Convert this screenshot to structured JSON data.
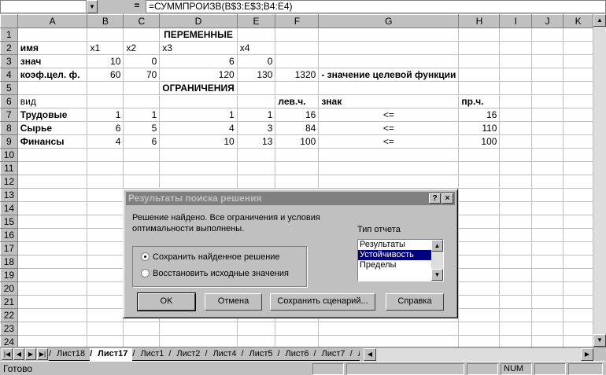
{
  "formula_bar": {
    "name_box": "",
    "equals": "=",
    "formula": "=СУММПРОИЗВ(B$3:E$3;B4:E4)"
  },
  "columns": [
    "A",
    "B",
    "C",
    "D",
    "E",
    "F",
    "G",
    "H",
    "I",
    "J",
    "K"
  ],
  "rows": [
    [
      "",
      "",
      "",
      "ПЕРЕМЕННЫЕ",
      "",
      "",
      "",
      "",
      "",
      "",
      ""
    ],
    [
      "имя",
      "x1",
      "x2",
      "x3",
      "x4",
      "",
      "",
      "",
      "",
      "",
      ""
    ],
    [
      "знач",
      "10",
      "0",
      "6",
      "0",
      "",
      "",
      "",
      "",
      "",
      ""
    ],
    [
      "коэф.цел. ф.",
      "60",
      "70",
      "120",
      "130",
      "1320",
      "- значение целевой функции",
      "",
      "",
      "",
      ""
    ],
    [
      "",
      "",
      "",
      "ОГРАНИЧЕНИЯ",
      "",
      "",
      "",
      "",
      "",
      "",
      ""
    ],
    [
      "вид",
      "",
      "",
      "",
      "",
      "лев.ч.",
      "знак",
      "пр.ч.",
      "",
      "",
      ""
    ],
    [
      "Трудовые",
      "1",
      "1",
      "1",
      "1",
      "16",
      "<=",
      "16",
      "",
      "",
      ""
    ],
    [
      "Сырье",
      "6",
      "5",
      "4",
      "3",
      "84",
      "<=",
      "110",
      "",
      "",
      ""
    ],
    [
      "Финансы",
      "4",
      "6",
      "10",
      "13",
      "100",
      "<=",
      "100",
      "",
      "",
      ""
    ],
    [
      "",
      "",
      "",
      "",
      "",
      "",
      "",
      "",
      "",
      "",
      ""
    ],
    [
      "",
      "",
      "",
      "",
      "",
      "",
      "",
      "",
      "",
      "",
      ""
    ],
    [
      "",
      "",
      "",
      "",
      "",
      "",
      "",
      "",
      "",
      "",
      ""
    ],
    [
      "",
      "",
      "",
      "",
      "",
      "",
      "",
      "",
      "",
      "",
      ""
    ],
    [
      "",
      "",
      "",
      "",
      "",
      "",
      "",
      "",
      "",
      "",
      ""
    ],
    [
      "",
      "",
      "",
      "",
      "",
      "",
      "",
      "",
      "",
      "",
      ""
    ],
    [
      "",
      "",
      "",
      "",
      "",
      "",
      "",
      "",
      "",
      "",
      ""
    ],
    [
      "",
      "",
      "",
      "",
      "",
      "",
      "",
      "",
      "",
      "",
      ""
    ],
    [
      "",
      "",
      "",
      "",
      "",
      "",
      "",
      "",
      "",
      "",
      ""
    ],
    [
      "",
      "",
      "",
      "",
      "",
      "",
      "",
      "",
      "",
      "",
      ""
    ],
    [
      "",
      "",
      "",
      "",
      "",
      "",
      "",
      "",
      "",
      "",
      ""
    ],
    [
      "",
      "",
      "",
      "",
      "",
      "",
      "",
      "",
      "",
      "",
      ""
    ],
    [
      "",
      "",
      "",
      "",
      "",
      "",
      "",
      "",
      "",
      "",
      ""
    ],
    [
      "",
      "",
      "",
      "",
      "",
      "",
      "",
      "",
      "",
      "",
      ""
    ],
    [
      "",
      "",
      "",
      "",
      "",
      "",
      "",
      "",
      "",
      "",
      ""
    ]
  ],
  "tabs": [
    "Лист18",
    "Лист17",
    "Лист1",
    "Лист2",
    "Лист4",
    "Лист5",
    "Лист6",
    "Лист7",
    "Л"
  ],
  "active_tab": "Лист17",
  "status": {
    "text": "Готово",
    "num": "NUM"
  },
  "dialog": {
    "title": "Результаты поиска решения",
    "help_btn": "?",
    "close_btn": "×",
    "message": "Решение найдено. Все ограничения и условия оптимальности выполнены.",
    "report_label": "Тип отчета",
    "reports": [
      "Результаты",
      "Устойчивость",
      "Пределы"
    ],
    "selected_report": "Устойчивость",
    "radio_keep": "Сохранить найденное решение",
    "radio_restore": "Восстановить исходные значения",
    "btn_ok": "OK",
    "btn_cancel": "Отмена",
    "btn_save_scenario": "Сохранить сценарий...",
    "btn_help": "Справка"
  }
}
